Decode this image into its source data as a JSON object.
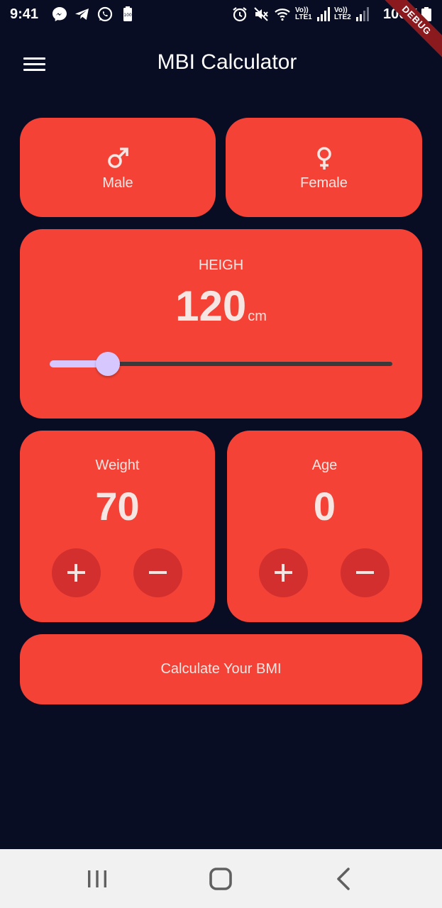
{
  "status_bar": {
    "time": "9:41",
    "left_icons": [
      "messenger-icon",
      "telegram-icon",
      "whatsapp-icon",
      "battery-100-icon"
    ],
    "right_icons": [
      "alarm-icon",
      "mute-icon",
      "wifi-icon",
      "lte1-signal-icon",
      "lte2-signal-icon"
    ],
    "lte1_label": "Vo)) LTE1",
    "lte2_label": "Vo)) LTE2",
    "battery_text": "100%",
    "debug_label": "DEBUG"
  },
  "app_bar": {
    "title": "MBI Calculator",
    "menu_icon": "menu-icon"
  },
  "gender": {
    "male_label": "Male",
    "female_label": "Female",
    "male_icon": "male-icon",
    "female_icon": "female-icon"
  },
  "height": {
    "label": "HEIGH",
    "value": "120",
    "unit": "cm",
    "slider_fraction": 0.17
  },
  "weight": {
    "label": "Weight",
    "value": "70"
  },
  "age": {
    "label": "Age",
    "value": "0"
  },
  "calculate_button": {
    "label": "Calculate Your BMI"
  },
  "nav_bar": {
    "recents_icon": "recents-icon",
    "home_icon": "home-icon",
    "back_icon": "back-icon"
  },
  "colors": {
    "background": "#080d23",
    "card": "#f44336",
    "card_button": "#d32f2f",
    "slider_accent": "#d6c7ff",
    "text": "#f5e6e4"
  }
}
